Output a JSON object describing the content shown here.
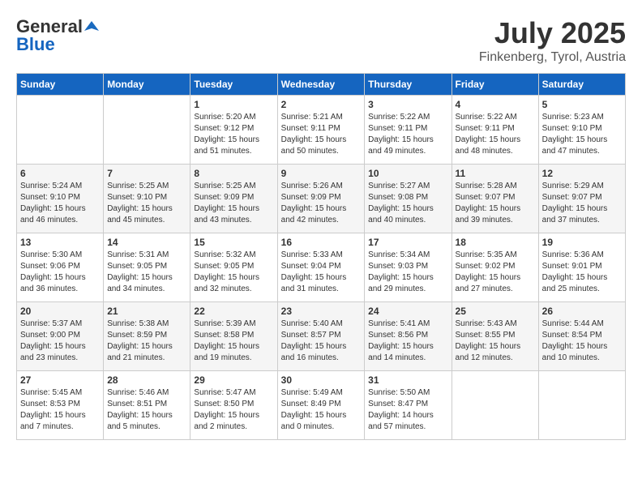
{
  "header": {
    "logo_general": "General",
    "logo_blue": "Blue",
    "month_year": "July 2025",
    "location": "Finkenberg, Tyrol, Austria"
  },
  "calendar": {
    "days_of_week": [
      "Sunday",
      "Monday",
      "Tuesday",
      "Wednesday",
      "Thursday",
      "Friday",
      "Saturday"
    ],
    "weeks": [
      [
        {
          "day": "",
          "info": ""
        },
        {
          "day": "",
          "info": ""
        },
        {
          "day": "1",
          "info": "Sunrise: 5:20 AM\nSunset: 9:12 PM\nDaylight: 15 hours\nand 51 minutes."
        },
        {
          "day": "2",
          "info": "Sunrise: 5:21 AM\nSunset: 9:11 PM\nDaylight: 15 hours\nand 50 minutes."
        },
        {
          "day": "3",
          "info": "Sunrise: 5:22 AM\nSunset: 9:11 PM\nDaylight: 15 hours\nand 49 minutes."
        },
        {
          "day": "4",
          "info": "Sunrise: 5:22 AM\nSunset: 9:11 PM\nDaylight: 15 hours\nand 48 minutes."
        },
        {
          "day": "5",
          "info": "Sunrise: 5:23 AM\nSunset: 9:10 PM\nDaylight: 15 hours\nand 47 minutes."
        }
      ],
      [
        {
          "day": "6",
          "info": "Sunrise: 5:24 AM\nSunset: 9:10 PM\nDaylight: 15 hours\nand 46 minutes."
        },
        {
          "day": "7",
          "info": "Sunrise: 5:25 AM\nSunset: 9:10 PM\nDaylight: 15 hours\nand 45 minutes."
        },
        {
          "day": "8",
          "info": "Sunrise: 5:25 AM\nSunset: 9:09 PM\nDaylight: 15 hours\nand 43 minutes."
        },
        {
          "day": "9",
          "info": "Sunrise: 5:26 AM\nSunset: 9:09 PM\nDaylight: 15 hours\nand 42 minutes."
        },
        {
          "day": "10",
          "info": "Sunrise: 5:27 AM\nSunset: 9:08 PM\nDaylight: 15 hours\nand 40 minutes."
        },
        {
          "day": "11",
          "info": "Sunrise: 5:28 AM\nSunset: 9:07 PM\nDaylight: 15 hours\nand 39 minutes."
        },
        {
          "day": "12",
          "info": "Sunrise: 5:29 AM\nSunset: 9:07 PM\nDaylight: 15 hours\nand 37 minutes."
        }
      ],
      [
        {
          "day": "13",
          "info": "Sunrise: 5:30 AM\nSunset: 9:06 PM\nDaylight: 15 hours\nand 36 minutes."
        },
        {
          "day": "14",
          "info": "Sunrise: 5:31 AM\nSunset: 9:05 PM\nDaylight: 15 hours\nand 34 minutes."
        },
        {
          "day": "15",
          "info": "Sunrise: 5:32 AM\nSunset: 9:05 PM\nDaylight: 15 hours\nand 32 minutes."
        },
        {
          "day": "16",
          "info": "Sunrise: 5:33 AM\nSunset: 9:04 PM\nDaylight: 15 hours\nand 31 minutes."
        },
        {
          "day": "17",
          "info": "Sunrise: 5:34 AM\nSunset: 9:03 PM\nDaylight: 15 hours\nand 29 minutes."
        },
        {
          "day": "18",
          "info": "Sunrise: 5:35 AM\nSunset: 9:02 PM\nDaylight: 15 hours\nand 27 minutes."
        },
        {
          "day": "19",
          "info": "Sunrise: 5:36 AM\nSunset: 9:01 PM\nDaylight: 15 hours\nand 25 minutes."
        }
      ],
      [
        {
          "day": "20",
          "info": "Sunrise: 5:37 AM\nSunset: 9:00 PM\nDaylight: 15 hours\nand 23 minutes."
        },
        {
          "day": "21",
          "info": "Sunrise: 5:38 AM\nSunset: 8:59 PM\nDaylight: 15 hours\nand 21 minutes."
        },
        {
          "day": "22",
          "info": "Sunrise: 5:39 AM\nSunset: 8:58 PM\nDaylight: 15 hours\nand 19 minutes."
        },
        {
          "day": "23",
          "info": "Sunrise: 5:40 AM\nSunset: 8:57 PM\nDaylight: 15 hours\nand 16 minutes."
        },
        {
          "day": "24",
          "info": "Sunrise: 5:41 AM\nSunset: 8:56 PM\nDaylight: 15 hours\nand 14 minutes."
        },
        {
          "day": "25",
          "info": "Sunrise: 5:43 AM\nSunset: 8:55 PM\nDaylight: 15 hours\nand 12 minutes."
        },
        {
          "day": "26",
          "info": "Sunrise: 5:44 AM\nSunset: 8:54 PM\nDaylight: 15 hours\nand 10 minutes."
        }
      ],
      [
        {
          "day": "27",
          "info": "Sunrise: 5:45 AM\nSunset: 8:53 PM\nDaylight: 15 hours\nand 7 minutes."
        },
        {
          "day": "28",
          "info": "Sunrise: 5:46 AM\nSunset: 8:51 PM\nDaylight: 15 hours\nand 5 minutes."
        },
        {
          "day": "29",
          "info": "Sunrise: 5:47 AM\nSunset: 8:50 PM\nDaylight: 15 hours\nand 2 minutes."
        },
        {
          "day": "30",
          "info": "Sunrise: 5:49 AM\nSunset: 8:49 PM\nDaylight: 15 hours\nand 0 minutes."
        },
        {
          "day": "31",
          "info": "Sunrise: 5:50 AM\nSunset: 8:47 PM\nDaylight: 14 hours\nand 57 minutes."
        },
        {
          "day": "",
          "info": ""
        },
        {
          "day": "",
          "info": ""
        }
      ]
    ]
  }
}
